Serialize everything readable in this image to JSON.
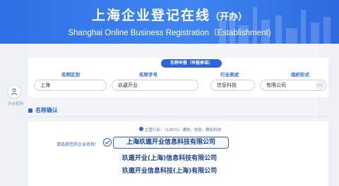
{
  "header": {
    "title_cn": "上海企业登记在线",
    "title_cn_suffix": "（开办）",
    "title_en": "Shanghai Online Business Registration（Establishment)"
  },
  "sidebar": {
    "side_label": "分支机构"
  },
  "name_apply": {
    "pill_label": "名称申报（申报承诺）",
    "columns": [
      {
        "label": "名称区划",
        "value": "上海"
      },
      {
        "label": "名称字号",
        "value": "玖遨开业"
      },
      {
        "label": "行业表述",
        "value": "信息科技"
      },
      {
        "label": "组织形式",
        "value": "有限公司"
      }
    ]
  },
  "section": {
    "title": "名称确认"
  },
  "result": {
    "info_text": "主营行业：（12671）通信，信息，数码科技",
    "choose_label": "请选择您的企业名称：",
    "options": [
      "上海玖遨开业信息科技有限公司",
      "玖遨开业(上海)信息科技有限公司",
      "玖遨开业信息科技(上海)有限公司"
    ],
    "selected_index": 0
  },
  "colors": {
    "brand_blue": "#2e64d6",
    "banner_blue": "#3f86f0",
    "option_text": "#1e3f96"
  }
}
